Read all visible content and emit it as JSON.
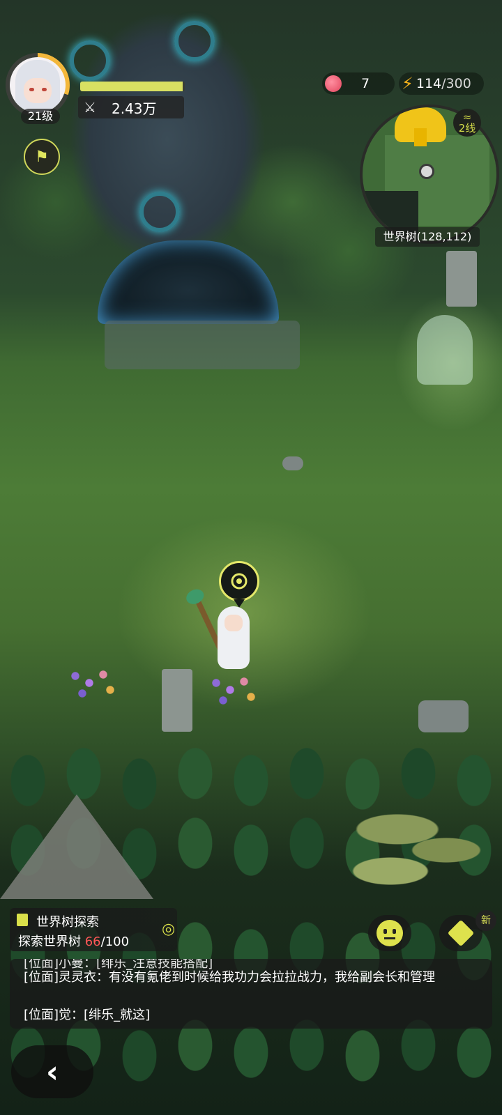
{
  "player": {
    "level": "21级",
    "hp_fraction": 0.98,
    "power": "2.43万",
    "power_icon": "crossed-swords-icon"
  },
  "resources": {
    "peach": "7",
    "energy_current": "114",
    "energy_max": "/300"
  },
  "minimap": {
    "line": "2线",
    "line_icon": "signal-icon",
    "label": "世界树(128,112)"
  },
  "quest": {
    "title": "世界树探索",
    "progress_label": "探索世界树 ",
    "progress_current": "66",
    "progress_total": "/100"
  },
  "new_badge": "新",
  "chat": {
    "partial_line": "[位面]小曼：[绯乐_注意技能搭配]",
    "line2": "[位面]灵灵衣：有没有氪佬到时候给我功力会拉拉战力，我给副会长和管理",
    "line3": "[位面]觉：[绯乐_就这]"
  },
  "back_icon": "‹",
  "colors": {
    "accent": "#dee24d",
    "progress_current": "#ff5757",
    "energy": "#f6b21c"
  }
}
